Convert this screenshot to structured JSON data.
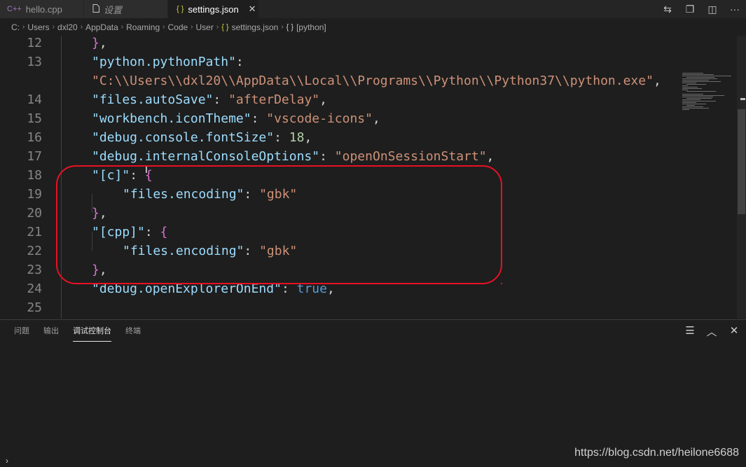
{
  "tabs": [
    {
      "label": "hello.cpp",
      "icon": "C++",
      "active": false
    },
    {
      "label": "设置",
      "icon": "file-icon",
      "active": false
    },
    {
      "label": "settings.json",
      "icon": "{ }",
      "active": true,
      "close": "✕"
    }
  ],
  "toolbar": {
    "compare_icon": "⇆",
    "open_preview_icon": "❐",
    "split_editor_icon": "◫",
    "more_icon": "···"
  },
  "breadcrumb": [
    "C:",
    "Users",
    "dxl20",
    "AppData",
    "Roaming",
    "Code",
    "User",
    "settings.json",
    "[python]"
  ],
  "breadcrumb_icons": {
    "json": "{ }",
    "object": "{ }"
  },
  "editor": {
    "lines": [
      {
        "num": "12",
        "tokens": [
          {
            "t": "}",
            "c": "br"
          },
          {
            "t": ",",
            "c": "p"
          }
        ]
      },
      {
        "num": "13",
        "tokens": [
          {
            "t": "\"python.pythonPath\"",
            "c": "k"
          },
          {
            "t": ":",
            "c": "p"
          }
        ]
      },
      {
        "num": "",
        "tokens": [
          {
            "t": "\"C:\\\\Users\\\\dxl20\\\\AppData\\\\Local\\\\Programs\\\\Python\\\\Python37\\\\python.exe\"",
            "c": "s"
          },
          {
            "t": ",",
            "c": "p"
          }
        ]
      },
      {
        "num": "14",
        "tokens": [
          {
            "t": "\"files.autoSave\"",
            "c": "k"
          },
          {
            "t": ": ",
            "c": "p"
          },
          {
            "t": "\"afterDelay\"",
            "c": "s"
          },
          {
            "t": ",",
            "c": "p"
          }
        ]
      },
      {
        "num": "15",
        "tokens": [
          {
            "t": "\"workbench.iconTheme\"",
            "c": "k"
          },
          {
            "t": ": ",
            "c": "p"
          },
          {
            "t": "\"vscode-icons\"",
            "c": "s"
          },
          {
            "t": ",",
            "c": "p"
          }
        ]
      },
      {
        "num": "16",
        "tokens": [
          {
            "t": "\"debug.console.fontSize\"",
            "c": "k"
          },
          {
            "t": ": ",
            "c": "p"
          },
          {
            "t": "18",
            "c": "n"
          },
          {
            "t": ",",
            "c": "p"
          }
        ]
      },
      {
        "num": "17",
        "tokens": [
          {
            "t": "\"debug.internalConsoleOptions\"",
            "c": "k"
          },
          {
            "t": ": ",
            "c": "p"
          },
          {
            "t": "\"openOnSessionStart\"",
            "c": "s"
          },
          {
            "t": ",",
            "c": "p"
          }
        ]
      },
      {
        "num": "18",
        "tokens": [
          {
            "t": "\"[c]\"",
            "c": "k"
          },
          {
            "t": ": ",
            "c": "p"
          },
          {
            "t": "{",
            "c": "br"
          }
        ]
      },
      {
        "num": "19",
        "indent": 2,
        "tokens": [
          {
            "t": "\"files.encoding\"",
            "c": "k"
          },
          {
            "t": ": ",
            "c": "p"
          },
          {
            "t": "\"gbk\"",
            "c": "s"
          }
        ]
      },
      {
        "num": "20",
        "tokens": [
          {
            "t": "}",
            "c": "br"
          },
          {
            "t": ",",
            "c": "p"
          }
        ]
      },
      {
        "num": "21",
        "tokens": [
          {
            "t": "\"[cpp]\"",
            "c": "k"
          },
          {
            "t": ": ",
            "c": "p"
          },
          {
            "t": "{",
            "c": "br"
          }
        ]
      },
      {
        "num": "22",
        "indent": 2,
        "tokens": [
          {
            "t": "\"files.encoding\"",
            "c": "k"
          },
          {
            "t": ": ",
            "c": "p"
          },
          {
            "t": "\"gbk\"",
            "c": "s"
          }
        ]
      },
      {
        "num": "23",
        "tokens": [
          {
            "t": "}",
            "c": "br"
          },
          {
            "t": ",",
            "c": "p"
          }
        ]
      },
      {
        "num": "24",
        "tokens": [
          {
            "t": "\"debug.openExplorerOnEnd\"",
            "c": "k"
          },
          {
            "t": ": ",
            "c": "p"
          },
          {
            "t": "true",
            "c": "b"
          },
          {
            "t": ",",
            "c": "p"
          }
        ]
      },
      {
        "num": "25",
        "tokens": []
      }
    ]
  },
  "panel": {
    "tabs": [
      {
        "label": "问题",
        "active": false
      },
      {
        "label": "输出",
        "active": false
      },
      {
        "label": "调试控制台",
        "active": true
      },
      {
        "label": "终端",
        "active": false
      }
    ],
    "icons": {
      "clear": "☰",
      "maximize": "︿",
      "close": "✕"
    }
  },
  "statusbar": {
    "chevron": "›"
  },
  "watermark": "https://blog.csdn.net/heilone6688",
  "colors": {
    "background": "#1e1e1e",
    "key": "#9cdcfe",
    "string": "#ce9178",
    "number": "#b5cea8",
    "boolean": "#569cd6",
    "bracket": "#da70d6",
    "highlight_box": "#e81123"
  }
}
